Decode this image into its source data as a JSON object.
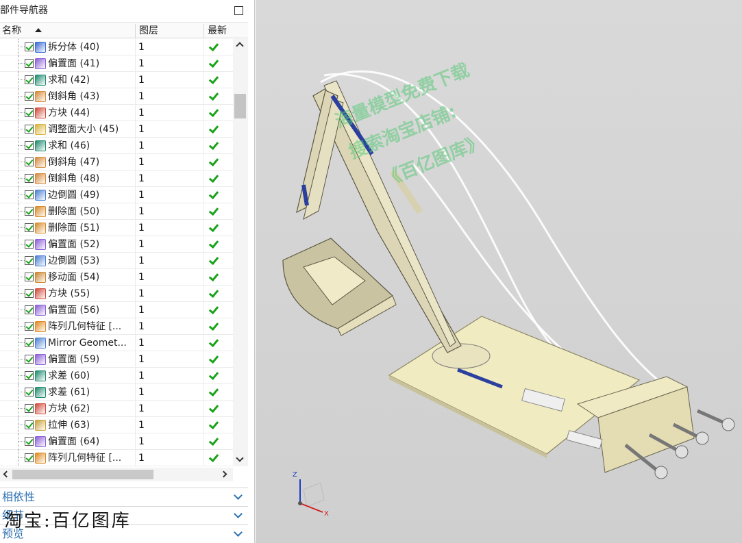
{
  "panel": {
    "title": "部件导航器",
    "columns": {
      "name": "名称",
      "layer": "图层",
      "latest": "最新"
    },
    "features": [
      {
        "name": "拆分体 (40)",
        "layer": "1",
        "icon": "split-body-icon",
        "color": "#3a6bd4"
      },
      {
        "name": "偏置面 (41)",
        "layer": "1",
        "icon": "offset-face-icon",
        "color": "#8a5fd6"
      },
      {
        "name": "求和 (42)",
        "layer": "1",
        "icon": "unite-icon",
        "color": "#1f8a6e"
      },
      {
        "name": "倒斜角 (43)",
        "layer": "1",
        "icon": "chamfer-icon",
        "color": "#d58a3a"
      },
      {
        "name": "方块 (44)",
        "layer": "1",
        "icon": "block-icon",
        "color": "#d04a3a"
      },
      {
        "name": "调整面大小 (45)",
        "layer": "1",
        "icon": "resize-face-icon",
        "color": "#d9b23a"
      },
      {
        "name": "求和 (46)",
        "layer": "1",
        "icon": "unite-icon",
        "color": "#1f8a6e"
      },
      {
        "name": "倒斜角 (47)",
        "layer": "1",
        "icon": "chamfer-icon",
        "color": "#d58a3a"
      },
      {
        "name": "倒斜角 (48)",
        "layer": "1",
        "icon": "chamfer-icon",
        "color": "#d58a3a"
      },
      {
        "name": "边倒圆 (49)",
        "layer": "1",
        "icon": "edge-blend-icon",
        "color": "#4a7fd1"
      },
      {
        "name": "删除面 (50)",
        "layer": "1",
        "icon": "delete-face-icon",
        "color": "#d88a2a"
      },
      {
        "name": "删除面 (51)",
        "layer": "1",
        "icon": "delete-face-icon",
        "color": "#d88a2a"
      },
      {
        "name": "偏置面 (52)",
        "layer": "1",
        "icon": "offset-face-icon",
        "color": "#8a5fd6"
      },
      {
        "name": "边倒圆 (53)",
        "layer": "1",
        "icon": "edge-blend-icon",
        "color": "#4a7fd1"
      },
      {
        "name": "移动面 (54)",
        "layer": "1",
        "icon": "move-face-icon",
        "color": "#c9852f"
      },
      {
        "name": "方块 (55)",
        "layer": "1",
        "icon": "block-icon",
        "color": "#d04a3a"
      },
      {
        "name": "偏置面 (56)",
        "layer": "1",
        "icon": "offset-face-icon",
        "color": "#8a5fd6"
      },
      {
        "name": "阵列几何特征 [...",
        "layer": "1",
        "icon": "pattern-geometry-icon",
        "color": "#e08a20"
      },
      {
        "name": "Mirror Geomet...",
        "layer": "1",
        "icon": "mirror-geometry-icon",
        "color": "#4a7fd1"
      },
      {
        "name": "偏置面 (59)",
        "layer": "1",
        "icon": "offset-face-icon",
        "color": "#8a5fd6"
      },
      {
        "name": "求差 (60)",
        "layer": "1",
        "icon": "subtract-icon",
        "color": "#1f8a6e"
      },
      {
        "name": "求差 (61)",
        "layer": "1",
        "icon": "subtract-icon",
        "color": "#1f8a6e"
      },
      {
        "name": "方块 (62)",
        "layer": "1",
        "icon": "block-icon",
        "color": "#d04a3a"
      },
      {
        "name": "拉伸 (63)",
        "layer": "1",
        "icon": "extrude-icon",
        "color": "#c9a03a"
      },
      {
        "name": "偏置面 (64)",
        "layer": "1",
        "icon": "offset-face-icon",
        "color": "#8a5fd6"
      },
      {
        "name": "阵列几何特征 [...",
        "layer": "1",
        "icon": "pattern-geometry-icon",
        "color": "#e08a20"
      }
    ],
    "sections": {
      "dependencies": "相依性",
      "details": "细节",
      "preview": "预览"
    },
    "shop_label": "淘宝:百亿图库"
  },
  "viewport": {
    "watermarks": [
      {
        "lines": [
          "海量模型免费下载",
          "搜索淘宝店铺:",
          "《百亿图库》"
        ]
      }
    ],
    "triad_labels": {
      "x": "X",
      "z": "Z"
    }
  },
  "colors": {
    "accent": "#2a6fb0",
    "check_green": "#1aa31a",
    "model_wood": "#e8e3c0",
    "model_blue": "#2b3f9e"
  }
}
